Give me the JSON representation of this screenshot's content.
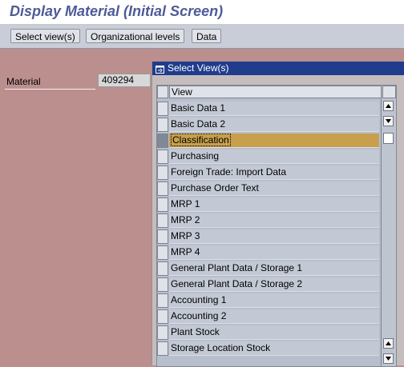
{
  "window": {
    "title": "Display Material (Initial Screen)"
  },
  "toolbar": {
    "buttons": [
      {
        "label": "Select view(s)"
      },
      {
        "label": "Organizational levels"
      },
      {
        "label": "Data"
      }
    ]
  },
  "form": {
    "material_label": "Material",
    "material_value": "409294"
  },
  "dialog": {
    "title": "Select View(s)",
    "column_header": "View",
    "selected_row": "Classification",
    "rows": [
      {
        "label": "Basic Data 1"
      },
      {
        "label": "Basic Data 2"
      },
      {
        "label": "Classification"
      },
      {
        "label": "Purchasing"
      },
      {
        "label": "Foreign Trade: Import Data"
      },
      {
        "label": "Purchase Order Text"
      },
      {
        "label": "MRP 1"
      },
      {
        "label": "MRP 2"
      },
      {
        "label": "MRP 3"
      },
      {
        "label": "MRP 4"
      },
      {
        "label": "General Plant Data / Storage 1"
      },
      {
        "label": "General Plant Data / Storage 2"
      },
      {
        "label": "Accounting 1"
      },
      {
        "label": "Accounting 2"
      },
      {
        "label": "Plant Stock"
      },
      {
        "label": "Storage Location Stock"
      }
    ]
  },
  "colors": {
    "background": "#bc8f8f",
    "title_text": "#4e5b97",
    "dialog_titlebar": "#203c8c",
    "selected_row": "#c8a04c"
  },
  "icons": [
    "dialog-window-icon",
    "scroll-up-arrow-icon",
    "scroll-down-arrow-icon"
  ]
}
